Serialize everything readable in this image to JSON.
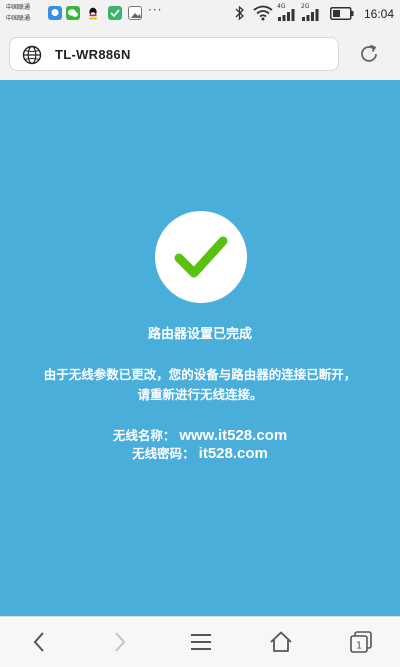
{
  "status_bar": {
    "carrier_1": "中国联通",
    "carrier_2": "中国联通",
    "more": "···",
    "signal_1_label": "4G",
    "signal_2_label": "2G",
    "time": "16:04"
  },
  "browser": {
    "url": "TL-WR886N"
  },
  "page": {
    "title": "路由器设置已完成",
    "message": "由于无线参数已更改，您的设备与路由器的连接已断开，请重新进行无线连接。",
    "ssid_label": "无线名称：",
    "ssid_value": "www.it528.com",
    "password_label": "无线密码：",
    "password_value": "it528.com"
  },
  "colors": {
    "content_background": "#4aaedb",
    "check_mark": "#5ac10f"
  },
  "icons": [
    "globe-icon",
    "reload-icon",
    "check-icon",
    "back-icon",
    "forward-icon",
    "menu-icon",
    "home-icon",
    "tabs-icon"
  ]
}
